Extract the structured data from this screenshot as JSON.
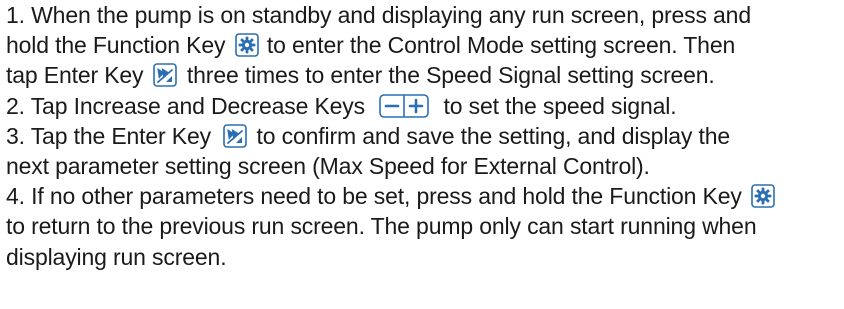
{
  "instructions": {
    "step1": {
      "part1": "1.  When the pump is on standby and displaying any run screen, press and",
      "part2": "hold the Function Key",
      "part3": "to enter the Control Mode setting screen. Then",
      "part4": "tap Enter Key",
      "part5": "three times to enter the Speed Signal setting screen."
    },
    "step2": {
      "part1": "2. Tap Increase and Decrease Keys",
      "part2": "to set the speed signal."
    },
    "step3": {
      "part1": "3. Tap the Enter Key",
      "part2": "to confirm and save the setting, and display the",
      "part3": "next parameter setting screen (Max Speed for External Control)."
    },
    "step4": {
      "part1": "4. If no other parameters need to be set, press and hold the Function Key",
      "part2": "to return to the previous run screen. The pump only can start running when",
      "part3": "displaying run screen."
    }
  },
  "icons": {
    "function_key": "gear-icon",
    "enter_key": "fast-forward-icon",
    "increase_decrease_keys": "minus-plus-icon"
  },
  "colors": {
    "text": "#1a1a1a",
    "key_border": "#2a6fb3",
    "key_fill": "#ffffff",
    "key_icon": "#2a6fb3"
  }
}
